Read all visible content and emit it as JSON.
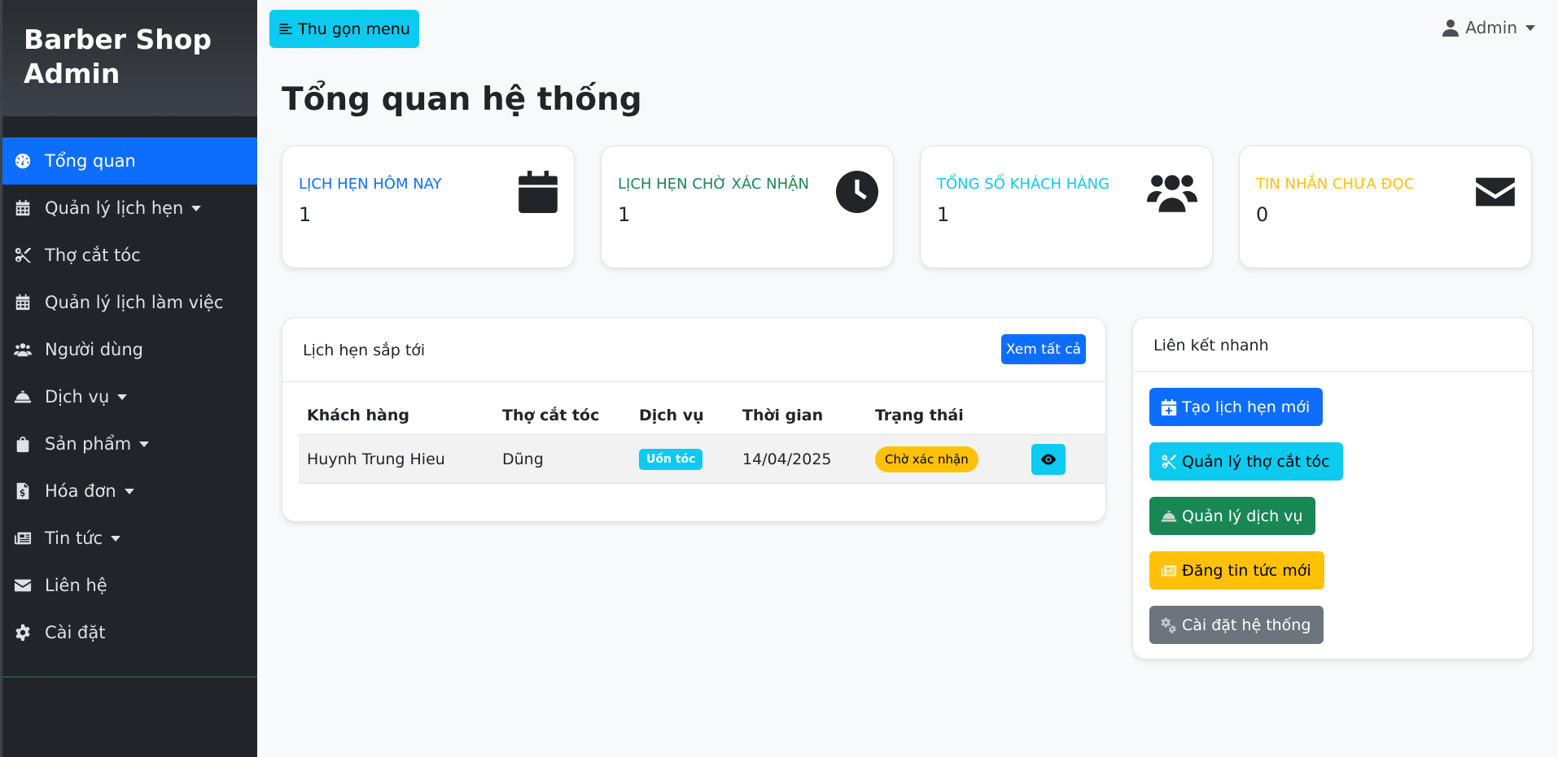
{
  "sidebar": {
    "brand": [
      "Barber Shop",
      "Admin"
    ],
    "items": [
      {
        "label": "Tổng quan",
        "icon": "dashboard-icon",
        "active": true,
        "dropdown": false
      },
      {
        "label": "Quản lý lịch hẹn",
        "icon": "calendar-icon",
        "active": false,
        "dropdown": true
      },
      {
        "label": "Thợ cắt tóc",
        "icon": "scissors-icon",
        "active": false,
        "dropdown": false
      },
      {
        "label": "Quản lý lịch làm việc",
        "icon": "calendar-icon",
        "active": false,
        "dropdown": false
      },
      {
        "label": "Người dùng",
        "icon": "users-icon",
        "active": false,
        "dropdown": false
      },
      {
        "label": "Dịch vụ",
        "icon": "bell-concierge-icon",
        "active": false,
        "dropdown": true
      },
      {
        "label": "Sản phẩm",
        "icon": "shopping-bag-icon",
        "active": false,
        "dropdown": true
      },
      {
        "label": "Hóa đơn",
        "icon": "invoice-icon",
        "active": false,
        "dropdown": true
      },
      {
        "label": "Tin tức",
        "icon": "newspaper-icon",
        "active": false,
        "dropdown": true
      },
      {
        "label": "Liên hệ",
        "icon": "envelope-icon",
        "active": false,
        "dropdown": false
      },
      {
        "label": "Cài đặt",
        "icon": "gear-icon",
        "active": false,
        "dropdown": false
      }
    ]
  },
  "topbar": {
    "toggle_label": "Thu gọn menu",
    "user_label": "Admin"
  },
  "page_title": "Tổng quan hệ thống",
  "stats": [
    {
      "label": "Lịch hẹn hôm nay",
      "value": "1",
      "color": "#0d6efd",
      "icon": "calendar-icon"
    },
    {
      "label": "Lịch hẹn chờ xác nhận",
      "value": "1",
      "color": "#198754",
      "icon": "clock-icon"
    },
    {
      "label": "Tổng số khách hàng",
      "value": "1",
      "color": "#0dcaf0",
      "icon": "users-icon"
    },
    {
      "label": "Tin nhắn chưa đọc",
      "value": "0",
      "color": "#ffc107",
      "icon": "envelope-icon"
    }
  ],
  "upcoming": {
    "title": "Lịch hẹn sắp tới",
    "view_all_label": "Xem tất cả",
    "columns": [
      "Khách hàng",
      "Thợ cắt tóc",
      "Dịch vụ",
      "Thời gian",
      "Trạng thái",
      ""
    ],
    "rows": [
      {
        "customer": "Huynh Trung Hieu",
        "barber": "Dũng",
        "service": "Uốn tóc",
        "time": "14/04/2025",
        "status": "Chờ xác nhận",
        "action_icon": "eye-icon"
      }
    ]
  },
  "quick_links": {
    "title": "Liên kết nhanh",
    "buttons": [
      {
        "label": "Tạo lịch hẹn mới",
        "icon": "calendar-plus-icon",
        "bg": "#0d6efd",
        "fg": "#ffffff"
      },
      {
        "label": "Quản lý thợ cắt tóc",
        "icon": "scissors-icon",
        "bg": "#0dcaf0",
        "fg": "#000000"
      },
      {
        "label": "Quản lý dịch vụ",
        "icon": "bell-concierge-icon",
        "bg": "#198754",
        "fg": "#ffffff"
      },
      {
        "label": "Đăng tin tức mới",
        "icon": "newspaper-icon",
        "bg": "#ffc107",
        "fg": "#000000"
      },
      {
        "label": "Cài đặt hệ thống",
        "icon": "gears-icon",
        "bg": "#6c757d",
        "fg": "#ffffff"
      }
    ]
  }
}
